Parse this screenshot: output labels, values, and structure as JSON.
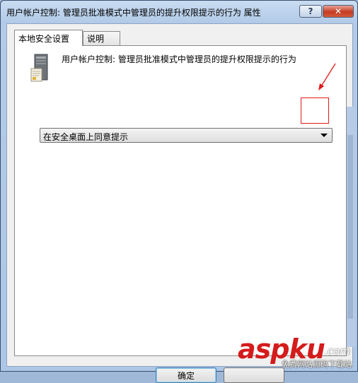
{
  "window": {
    "title": "用户帐户控制: 管理员批准模式中管理员的提升权限提示的行为 属性",
    "help_glyph": "?",
    "close_glyph": "✕"
  },
  "tabs": [
    {
      "label": "本地安全设置",
      "active": true
    },
    {
      "label": "说明",
      "active": false
    }
  ],
  "policy": {
    "icon": "policy-computer-icon",
    "description": "用户帐户控制: 管理员批准模式中管理员的提升权限提示的行为"
  },
  "combo": {
    "selected": "在安全桌面上同意提示"
  },
  "buttons": {
    "ok": "确定",
    "cancel": ""
  },
  "annotation": {
    "color": "#e01818"
  },
  "watermark": {
    "logo_text": "aspku",
    "com_text": ".com",
    "sub_text": "免费网站源码下载站"
  }
}
